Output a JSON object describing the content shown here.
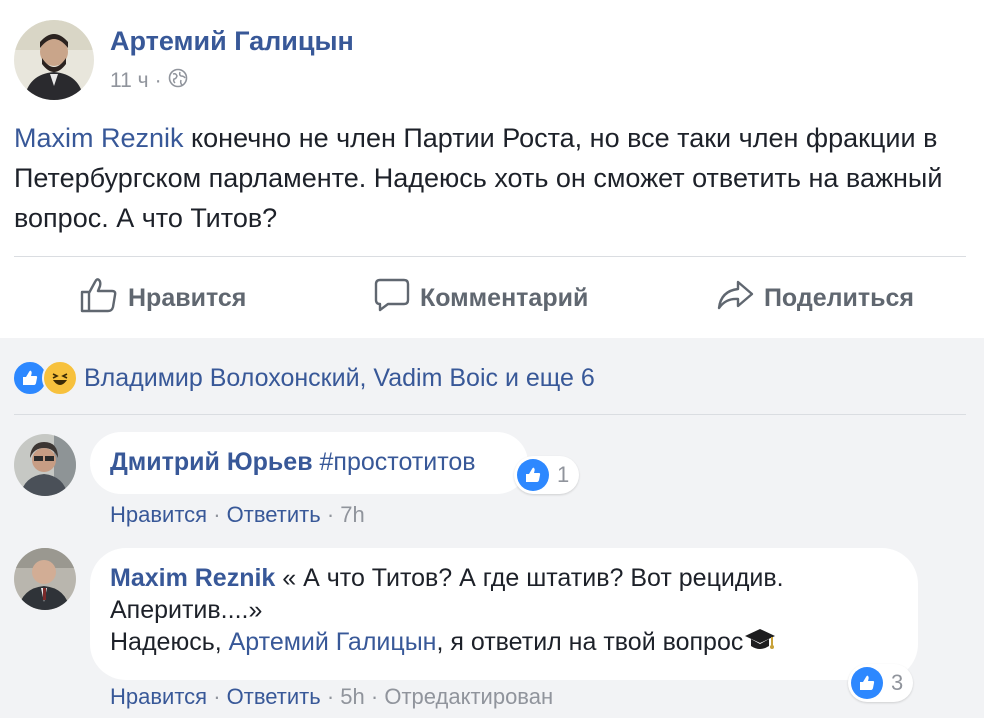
{
  "post": {
    "author": "Артемий Галицын",
    "time": "11 ч",
    "separator": "·",
    "mention": "Maxim Reznik",
    "text": " конечно не член Партии Роста, но все таки член фракции в Петербургском парламенте. Надеюсь хоть он сможет ответить на важный вопрос. А что Титов?"
  },
  "actions": {
    "like": "Нравится",
    "comment": "Комментарий",
    "share": "Поделиться"
  },
  "reactions": {
    "text": "Владимир Волохонский, Vadim Boic и еще 6"
  },
  "comments": [
    {
      "name": "Дмитрий Юрьев",
      "text": "#простотитов",
      "like": "Нравится",
      "reply": "Ответить",
      "time": "7h",
      "sep": "·",
      "likes": "1"
    },
    {
      "name": "Maxim Reznik",
      "text1": "« А что Титов? А где штатив? Вот рецидив. Аперитив....»",
      "text2_pre": "Надеюсь, ",
      "mention": "Артемий Галицын",
      "text2_post": ", я ответил на твой вопрос",
      "like": "Нравится",
      "reply": "Ответить",
      "time": "5h",
      "edited": "Отредактирован",
      "sep": "·",
      "likes": "3"
    }
  ],
  "colors": {
    "link": "#385898",
    "meta": "#90949c",
    "comments_bg": "#f2f3f5",
    "like_blue": "#2d88ff",
    "haha_yellow": "#f7c13d"
  }
}
